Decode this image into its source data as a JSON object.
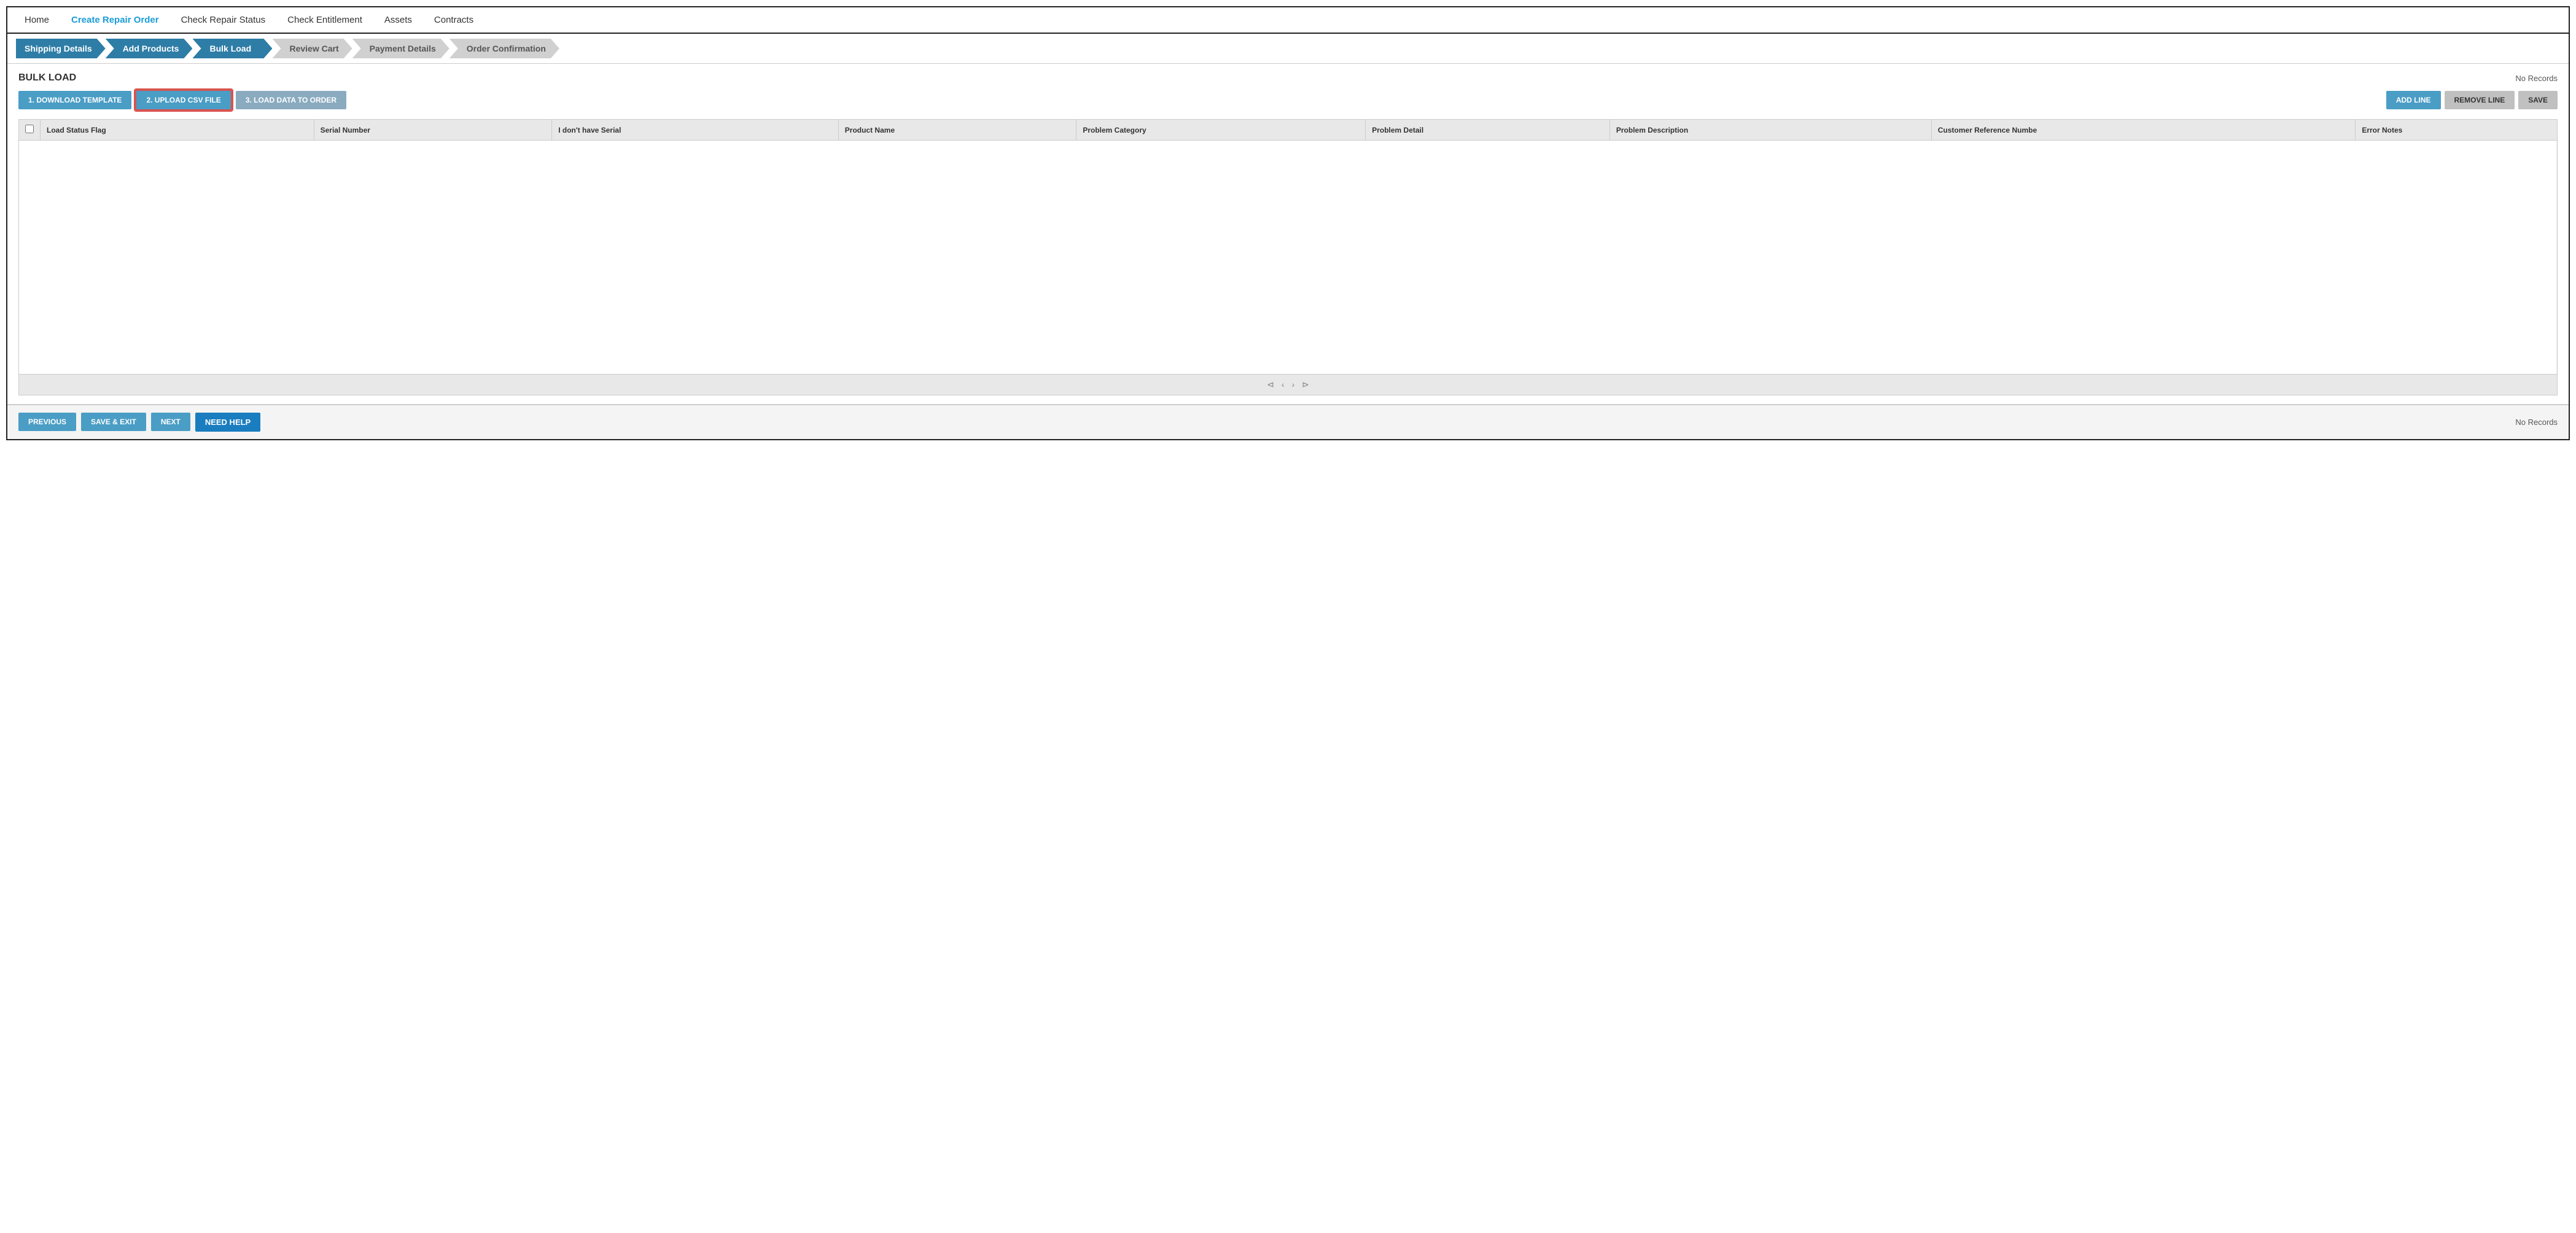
{
  "nav": {
    "items": [
      {
        "id": "home",
        "label": "Home",
        "active": false
      },
      {
        "id": "create-repair-order",
        "label": "Create Repair Order",
        "active": true
      },
      {
        "id": "check-repair-status",
        "label": "Check Repair Status",
        "active": false
      },
      {
        "id": "check-entitlement",
        "label": "Check Entitlement",
        "active": false
      },
      {
        "id": "assets",
        "label": "Assets",
        "active": false
      },
      {
        "id": "contracts",
        "label": "Contracts",
        "active": false
      }
    ]
  },
  "steps": [
    {
      "id": "shipping-details",
      "label": "Shipping Details",
      "state": "completed"
    },
    {
      "id": "add-products",
      "label": "Add Products",
      "state": "completed"
    },
    {
      "id": "bulk-load",
      "label": "Bulk Load",
      "state": "active"
    },
    {
      "id": "review-cart",
      "label": "Review Cart",
      "state": "inactive"
    },
    {
      "id": "payment-details",
      "label": "Payment Details",
      "state": "inactive"
    },
    {
      "id": "order-confirmation",
      "label": "Order Confirmation",
      "state": "inactive"
    }
  ],
  "bulk_load": {
    "title": "BULK LOAD",
    "no_records_top": "No Records",
    "no_records_bottom": "No Records",
    "buttons": {
      "download_template": "1. DOWNLOAD TEMPLATE",
      "upload_csv": "2. UPLOAD CSV FILE",
      "load_data": "3. LOAD DATA TO ORDER",
      "add_line": "ADD LINE",
      "remove_line": "REMOVE LINE",
      "save": "SAVE"
    },
    "table": {
      "columns": [
        {
          "id": "checkbox",
          "label": ""
        },
        {
          "id": "load-status-flag",
          "label": "Load Status Flag"
        },
        {
          "id": "serial-number",
          "label": "Serial Number"
        },
        {
          "id": "no-serial",
          "label": "I don't have Serial"
        },
        {
          "id": "product-name",
          "label": "Product Name"
        },
        {
          "id": "problem-category",
          "label": "Problem Category"
        },
        {
          "id": "problem-detail",
          "label": "Problem Detail"
        },
        {
          "id": "problem-description",
          "label": "Problem Description"
        },
        {
          "id": "customer-ref",
          "label": "Customer Reference Numbe"
        },
        {
          "id": "error-notes",
          "label": "Error Notes"
        }
      ],
      "rows": []
    },
    "pagination": {
      "first": "⊲",
      "prev": "‹",
      "next": "›",
      "last": "⊳"
    }
  },
  "bottom_buttons": {
    "previous": "PREVIOUS",
    "save_exit": "SAVE & EXIT",
    "next": "NEXT",
    "need_help": "NEED HELP"
  }
}
